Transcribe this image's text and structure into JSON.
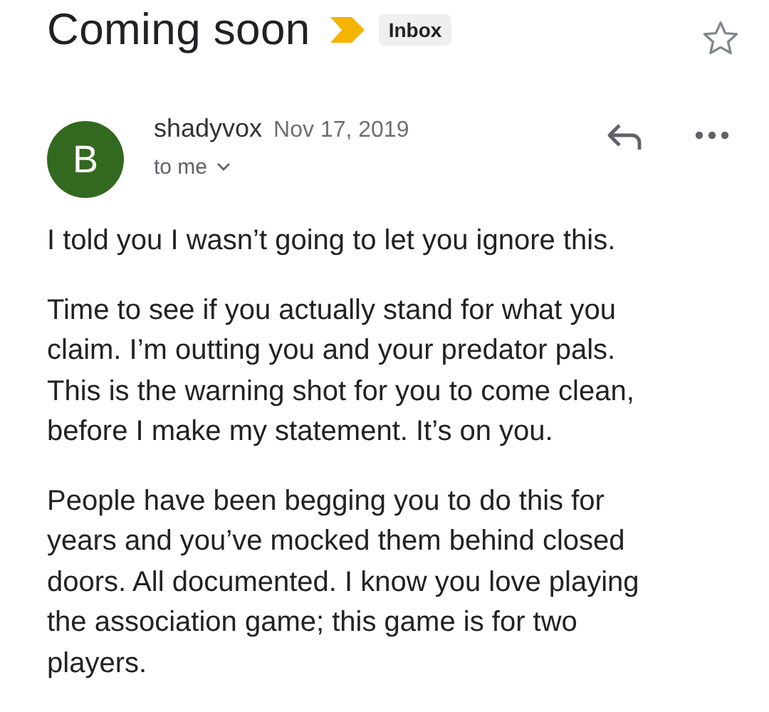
{
  "subject": "Coming soon",
  "important": true,
  "label": "Inbox",
  "starred": false,
  "message": {
    "avatar_letter": "B",
    "sender": "shadyvox",
    "date": "Nov 17, 2019",
    "recipient": "to me"
  },
  "body": [
    "I told you I wasn’t going to let you ignore this.",
    "Time to see if you actually stand for what you\nclaim. I’m outting you and your predator pals.\nThis is the warning shot for you to come clean,\nbefore I make my statement. It’s on you.",
    "People have been begging you to do this for\nyears and you’ve mocked them behind closed\ndoors. All documented. I know you love playing\nthe association game; this game is for two\nplayers."
  ]
}
